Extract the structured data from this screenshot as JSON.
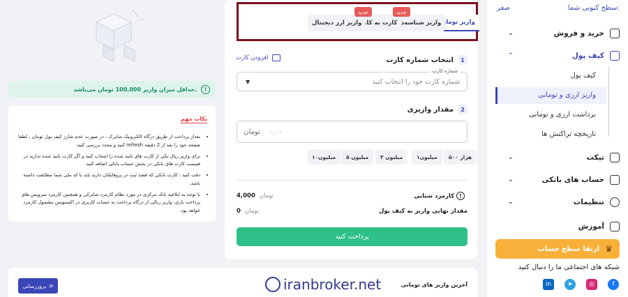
{
  "sidebar": {
    "level_label": "سطح کنونی شما:",
    "level_value": "صفر",
    "items": [
      {
        "label": "خرید و فروش"
      },
      {
        "label": "کیف پول"
      },
      {
        "label": "تیکت"
      },
      {
        "label": "حساب های بانکی"
      },
      {
        "label": "تنظیمات"
      },
      {
        "label": "آموزش"
      }
    ],
    "sub_items": [
      {
        "label": "کیف پول"
      },
      {
        "label": "واریز ارزی و تومانی"
      },
      {
        "label": "برداشت ارزی و تومانی"
      },
      {
        "label": "تاریخچه تراکنش ها"
      }
    ],
    "upgrade_label": "ارتقا سطح حساب",
    "social_label": "شبکه های اجتماعی ما را دنبال کنید",
    "social_icons": [
      "facebook-icon",
      "instagram-icon",
      "telegram-icon",
      "linkedin-icon"
    ]
  },
  "tabs": [
    {
      "label": "واریز تومان"
    },
    {
      "label": "واریز شناسه‌دار"
    },
    {
      "label": "کارت به کارت"
    },
    {
      "label": "واریز ارز دیجیتال"
    }
  ],
  "badge_new": "جدید",
  "form": {
    "step1_num": "1",
    "step1_title": "انتخاب شماره کارت",
    "add_card": "افزودن کارت",
    "card_label": "شماره کارت",
    "card_placeholder": "شماره کارت خود را انتخاب کنید",
    "step2_num": "2",
    "step2_title": "مقدار واریزی",
    "amount_unit": "تومان",
    "amount_placeholder": "۰.۰۰",
    "chips": [
      "۵۰۰ هزار",
      "۱میلیون",
      "۳ میلیون",
      "۵ میلیون",
      "۱۰میلیون"
    ],
    "fee_label": "کارمزد شتابی",
    "fee_value": "4,000",
    "fee_unit": "تومان",
    "final_label": "مقدار نهایی واریز به کیف پول",
    "final_value": "0",
    "final_unit": "تومان",
    "pay_button": "پرداخت کنید"
  },
  "minimum_notice": "حداقل میزان واریز 100,000 تومان می‌باشد.",
  "notes": {
    "title": "نکات مهم",
    "items": [
      "بعداز پرداخت از طریق درگاه الکترونیک شاپرک ، در صورت عدم شارژ کیف پول تومان ، لطفا صفحه خود را بعد از 2 دقیقه refresh کنید و مجدد بررسی کنید.",
      "برای واریز ریال یکی از کارت های تایید شده را انتخاب کنید و اگر کارت تایید شده ندارید در قسمت کارت های بانکی در بخش حساب بانکی اضافه کنید.",
      "دقت کنید ، کارت بانکی که قصد ثبت در پروفایلتان دارید باید با کد ملی شما مطابقت داشته باشد.",
      "با توجه به ابلاغیه بانک مرکزی در مورد نظام کارمزد شاپرکی و همچنین کارمزد سرویس های پرداخت یاری، واریز ریالی از درگاه پرداخت به حساب کاربری در اکسنویس مشمول کارمزد خواهد بود."
    ]
  },
  "bottom": {
    "title": "آخرین واریز های تومانی",
    "refresh": "بروزرسانی"
  },
  "watermark": "iranbroker.net"
}
